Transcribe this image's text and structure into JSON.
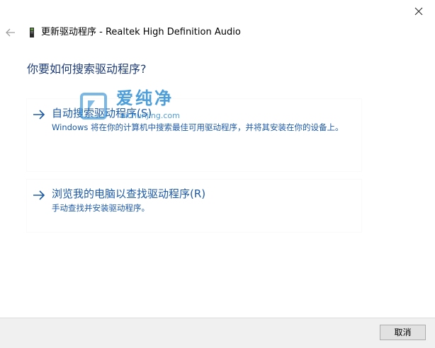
{
  "window": {
    "title": "更新驱动程序 - Realtek High Definition Audio",
    "back_icon": "back-arrow-icon",
    "close_icon": "close-icon",
    "device_icon": "audio-device-icon"
  },
  "main": {
    "question": "你要如何搜索驱动程序?",
    "options": [
      {
        "icon": "arrow-right-icon",
        "title": "自动搜索驱动程序(S)",
        "description": "Windows 将在你的计算机中搜索最佳可用驱动程序，并将其安装在你的设备上。"
      },
      {
        "icon": "arrow-right-icon",
        "title": "浏览我的电脑以查找驱动程序(R)",
        "description": "手动查找并安装驱动程序。"
      }
    ]
  },
  "watermark": {
    "text": "爱纯净",
    "url": "aichunjing.com"
  },
  "footer": {
    "cancel_label": "取消"
  },
  "colors": {
    "link_blue": "#1c5aa8",
    "heading_blue": "#1e3c78",
    "footer_bg": "#f0f0f0",
    "watermark_blue": "#2e8fd6"
  }
}
